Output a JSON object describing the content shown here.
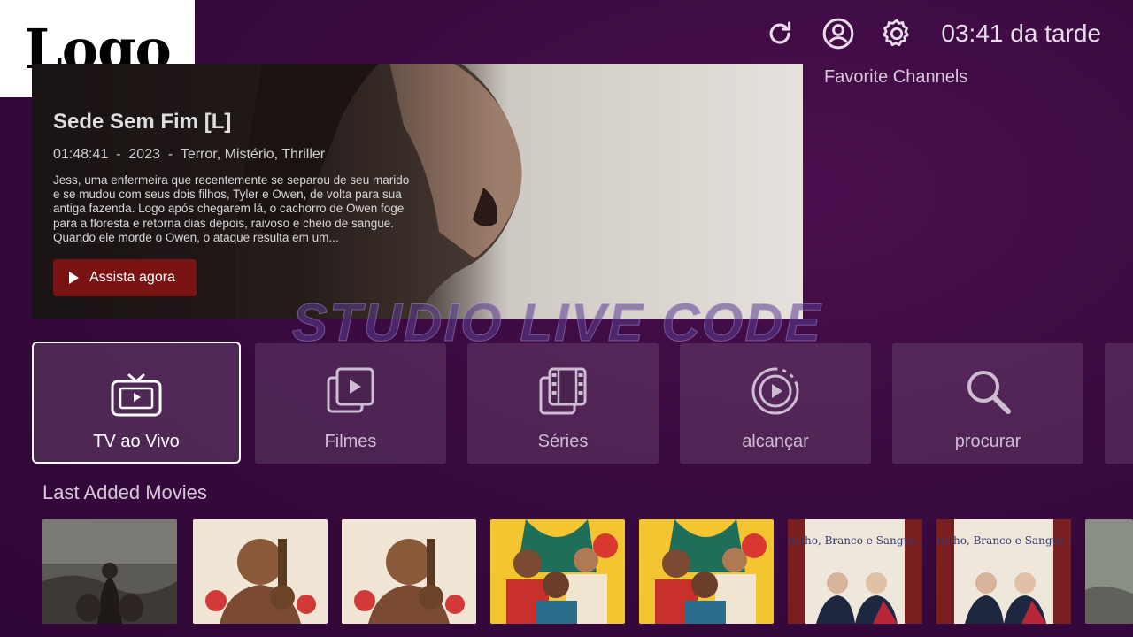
{
  "logo": {
    "text": "Logo"
  },
  "topbar": {
    "clock": "03:41 da tarde",
    "icons": [
      "refresh-icon",
      "profile-icon",
      "settings-icon"
    ]
  },
  "hero": {
    "title": "Sede Sem Fim [L]",
    "duration": "01:48:41",
    "year": "2023",
    "genres": "Terror, Mistério, Thriller",
    "separator": "-",
    "description": "Jess, uma enfermeira que recentemente se separou de seu marido e se mudou com seus dois filhos, Tyler e Owen, de volta para sua antiga fazenda. Logo após chegarem lá, o cachorro de Owen foge para a floresta e retorna dias depois, raivoso e cheio de sangue. Quando ele morde o Owen, o ataque resulta em um...",
    "watch_label": "Assista agora"
  },
  "favorites": {
    "title": "Favorite Channels"
  },
  "watermark": {
    "text": "STUDIO LIVE CODE"
  },
  "categories": [
    {
      "label": "TV ao Vivo",
      "icon": "tv-icon",
      "active": true
    },
    {
      "label": "Filmes",
      "icon": "movies-icon",
      "active": false
    },
    {
      "label": "Séries",
      "icon": "series-icon",
      "active": false
    },
    {
      "label": "alcançar",
      "icon": "catchup-icon",
      "active": false
    },
    {
      "label": "procurar",
      "icon": "search-icon",
      "active": false
    }
  ],
  "last_added": {
    "title": "Last Added Movies",
    "posters": [
      {
        "title_text": ""
      },
      {
        "title_text": ""
      },
      {
        "title_text": ""
      },
      {
        "title_text": ""
      },
      {
        "title_text": ""
      },
      {
        "title_text": "Vermelho, Branco e Sangue Azul"
      },
      {
        "title_text": "Vermelho, Branco e Sangue Azul"
      },
      {
        "title_text": ""
      }
    ]
  },
  "colors": {
    "background": "#3a0a40",
    "accent_button": "#7a1414",
    "tile_bg": "rgba(255,255,255,0.11)"
  }
}
